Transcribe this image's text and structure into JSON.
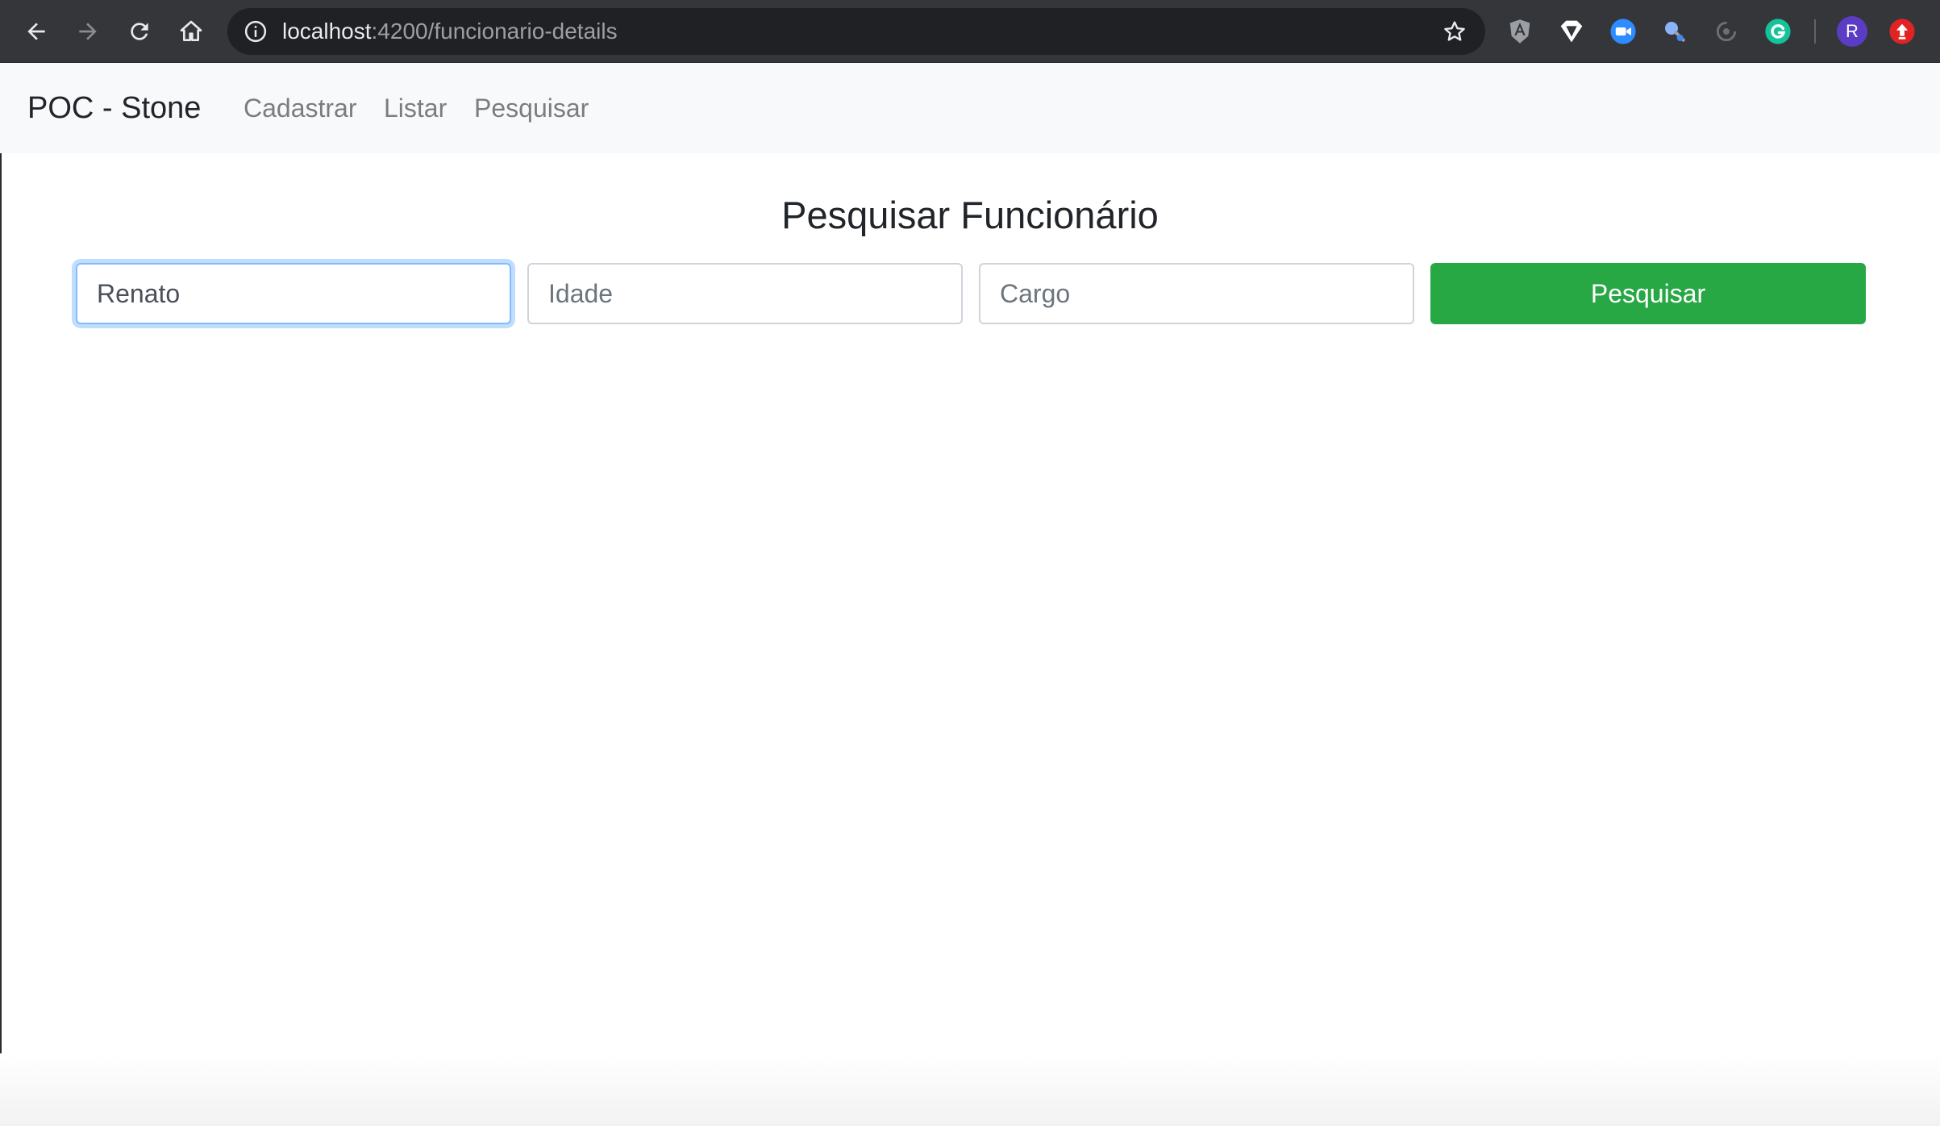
{
  "browser": {
    "url_host": "localhost",
    "url_path": ":4200/funcionario-details",
    "profile_initial": "R",
    "extensions": [
      "angular-icon",
      "shield-extension-icon",
      "zoom-extension-icon",
      "magnifier-extension-icon",
      "sync-extension-icon",
      "grammarly-icon",
      "upload-extension-icon"
    ]
  },
  "navbar": {
    "brand": "POC - Stone",
    "links": [
      "Cadastrar",
      "Listar",
      "Pesquisar"
    ]
  },
  "main": {
    "title": "Pesquisar Funcionário",
    "name_value": "Renato",
    "age_placeholder": "Idade",
    "role_placeholder": "Cargo",
    "search_label": "Pesquisar"
  },
  "colors": {
    "button": "#28a745",
    "focus_border": "#80bdff",
    "navbar_bg": "#f8f9fa",
    "chrome_bg": "#35363a"
  }
}
